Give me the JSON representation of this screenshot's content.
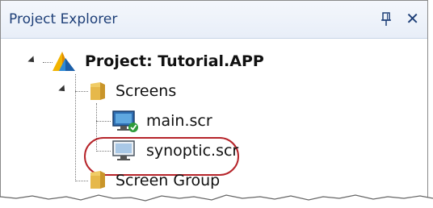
{
  "panel": {
    "title": "Project Explorer",
    "pin_icon": "pin-icon",
    "close_label": "✕"
  },
  "tree": {
    "project": "Project: Tutorial.APP",
    "screens_folder": "Screens",
    "screen_main": "main.scr",
    "screen_synoptic": "synoptic.scr",
    "screen_group": "Screen Group"
  },
  "colors": {
    "title_text": "#1e3f78",
    "highlight": "#b6242a",
    "folder": "#e6b84a"
  }
}
